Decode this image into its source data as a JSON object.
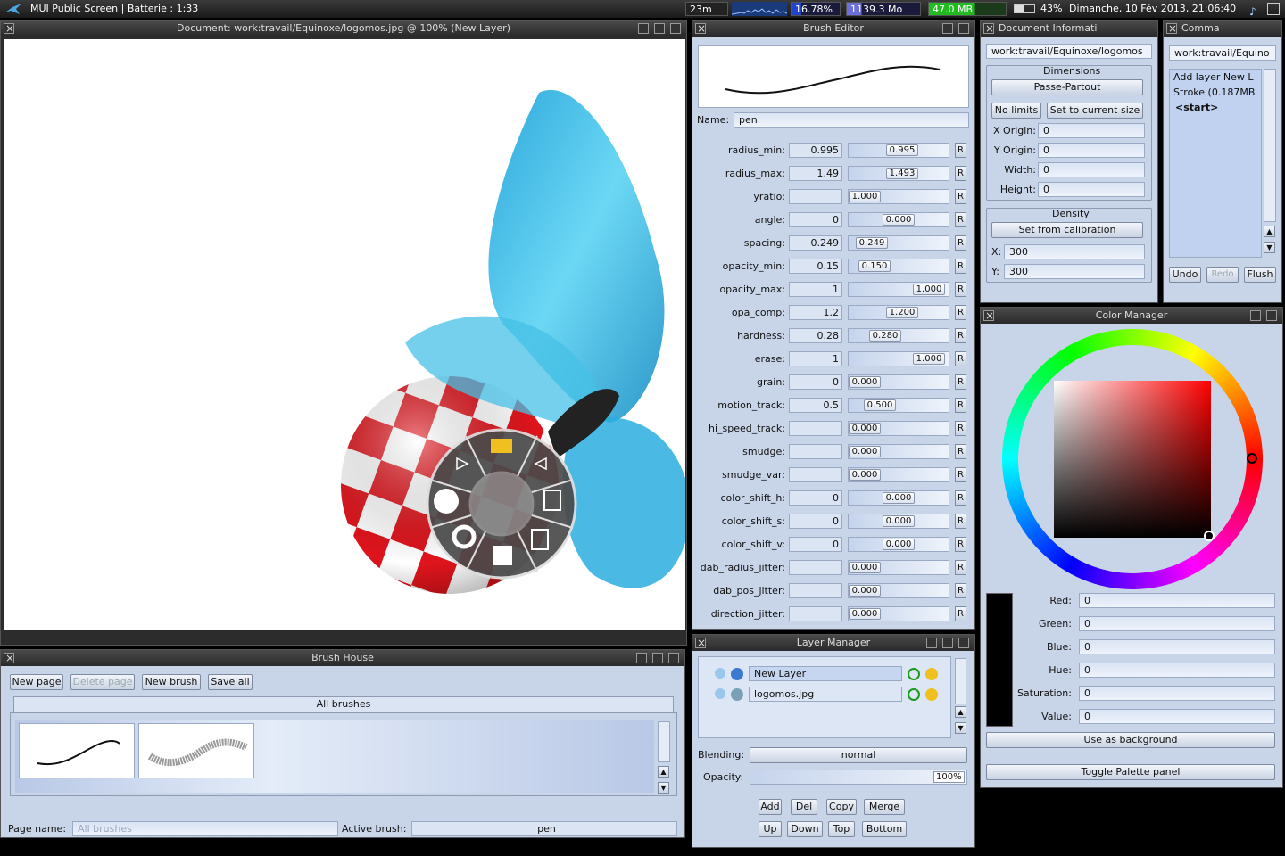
{
  "screenbar": {
    "title": "MUI Public Screen | Batterie : 1:33",
    "time_left": "23m",
    "cpu": "16.78%",
    "mem1": "1139.3 Mo",
    "mem2": "47.0 MB",
    "battery": "43%",
    "datetime": "Dimanche, 10 Fév 2013, 21:06:40"
  },
  "document": {
    "title": "Document: work:travail/Equinoxe/logomos.jpg @  100% (New Layer)"
  },
  "brush_editor": {
    "title": "Brush Editor",
    "name_label": "Name:",
    "name_value": "pen",
    "params": [
      {
        "name": "radius_min:",
        "value": "0.995",
        "slider": "0.995",
        "fill": 0.55
      },
      {
        "name": "radius_max:",
        "value": "1.49",
        "slider": "1.493",
        "fill": 0.55
      },
      {
        "name": "yratio:",
        "value": "",
        "slider": "1.000",
        "fill": 0.0
      },
      {
        "name": "angle:",
        "value": "0",
        "slider": "0.000",
        "fill": 0.5
      },
      {
        "name": "spacing:",
        "value": "0.249",
        "slider": "0.249",
        "fill": 0.1
      },
      {
        "name": "opacity_min:",
        "value": "0.15",
        "slider": "0.150",
        "fill": 0.15
      },
      {
        "name": "opacity_max:",
        "value": "1",
        "slider": "1.000",
        "fill": 0.95
      },
      {
        "name": "opa_comp:",
        "value": "1.2",
        "slider": "1.200",
        "fill": 0.55
      },
      {
        "name": "hardness:",
        "value": "0.28",
        "slider": "0.280",
        "fill": 0.3
      },
      {
        "name": "erase:",
        "value": "1",
        "slider": "1.000",
        "fill": 0.95
      },
      {
        "name": "grain:",
        "value": "0",
        "slider": "0.000",
        "fill": 0.0
      },
      {
        "name": "motion_track:",
        "value": "0.5",
        "slider": "0.500",
        "fill": 0.22
      },
      {
        "name": "hi_speed_track:",
        "value": "",
        "slider": "0.000",
        "fill": 0.0
      },
      {
        "name": "smudge:",
        "value": "",
        "slider": "0.000",
        "fill": 0.0
      },
      {
        "name": "smudge_var:",
        "value": "",
        "slider": "0.000",
        "fill": 0.0
      },
      {
        "name": "color_shift_h:",
        "value": "0",
        "slider": "0.000",
        "fill": 0.5
      },
      {
        "name": "color_shift_s:",
        "value": "0",
        "slider": "0.000",
        "fill": 0.5
      },
      {
        "name": "color_shift_v:",
        "value": "0",
        "slider": "0.000",
        "fill": 0.5
      },
      {
        "name": "dab_radius_jitter:",
        "value": "",
        "slider": "0.000",
        "fill": 0.0
      },
      {
        "name": "dab_pos_jitter:",
        "value": "",
        "slider": "0.000",
        "fill": 0.0
      },
      {
        "name": "direction_jitter:",
        "value": "",
        "slider": "0.000",
        "fill": 0.0
      }
    ],
    "reset_label": "R"
  },
  "doc_info": {
    "title": "Document Informati",
    "path": "work:travail/Equinoxe/logomos",
    "dimensions_label": "Dimensions",
    "passe_partout": "Passe-Partout",
    "no_limits": "No limits",
    "set_current": "Set to current size",
    "x_origin_label": "X Origin:",
    "x_origin": "0",
    "y_origin_label": "Y Origin:",
    "y_origin": "0",
    "width_label": "Width:",
    "width": "0",
    "height_label": "Height:",
    "height": "0",
    "density_label": "Density",
    "set_calibration": "Set from calibration",
    "x_label": "X:",
    "x": "300",
    "y_label": "Y:",
    "y": "300"
  },
  "commands": {
    "title": "Comma",
    "path": "work:travail/Equino",
    "items": [
      "Add layer New L",
      "Stroke (0.187MB",
      "<start>"
    ],
    "undo": "Undo",
    "redo": "Redo",
    "flush": "Flush"
  },
  "color_manager": {
    "title": "Color Manager",
    "red_label": "Red:",
    "red": "0",
    "green_label": "Green:",
    "green": "0",
    "blue_label": "Blue:",
    "blue": "0",
    "hue_label": "Hue:",
    "hue": "0",
    "sat_label": "Saturation:",
    "sat": "0",
    "val_label": "Value:",
    "val": "0",
    "use_bg": "Use as background",
    "toggle_palette": "Toggle Palette panel"
  },
  "layer_manager": {
    "title": "Layer Manager",
    "layers": [
      "New Layer",
      "logomos.jpg"
    ],
    "blending_label": "Blending:",
    "blending": "normal",
    "opacity_label": "Opacity:",
    "opacity": "100%",
    "add": "Add",
    "del": "Del",
    "copy": "Copy",
    "merge": "Merge",
    "up": "Up",
    "down": "Down",
    "top": "Top",
    "bottom": "Bottom"
  },
  "brush_house": {
    "title": "Brush House",
    "new_page": "New page",
    "delete_page": "Delete page",
    "new_brush": "New brush",
    "save_all": "Save all",
    "tab": "All brushes",
    "page_name_label": "Page name:",
    "page_name": "All brushes",
    "active_brush_label": "Active brush:",
    "active_brush": "pen"
  }
}
